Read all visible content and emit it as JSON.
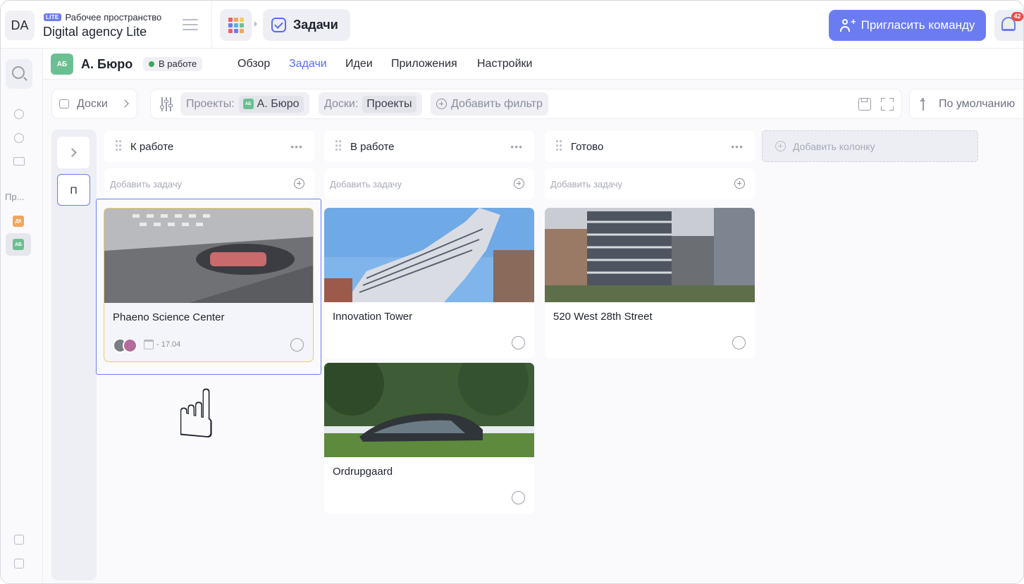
{
  "workspace": {
    "avatar": "DA",
    "badge": "LITE",
    "subtitle": "Рабочее пространство",
    "name": "Digital agency Lite"
  },
  "breadcrumb": {
    "current": "Задачи"
  },
  "header": {
    "invite_label": "Пригласить команду",
    "notifications_count": "42"
  },
  "sidebar": {
    "section_label": "Пр...",
    "projects": [
      {
        "abbr": "ДК",
        "color": "#f2a65a"
      },
      {
        "abbr": "АБ",
        "color": "#6bbf92"
      }
    ]
  },
  "project": {
    "abbr": "АБ",
    "name": "А. Бюро",
    "status": "В работе",
    "tabs": [
      "Обзор",
      "Задачи",
      "Идеи",
      "Приложения",
      "Настройки"
    ],
    "active_tab": "Задачи"
  },
  "filters": {
    "boards_label": "Доски",
    "projects_label": "Проекты:",
    "projects_value": "А. Бюро",
    "projects_value_abbr": "АБ",
    "boards_filter_label": "Доски:",
    "boards_filter_value": "Проекты",
    "add_filter": "Добавить фильтр",
    "sort_label": "По умолчанию"
  },
  "board": {
    "collapsed_column_letter": "П",
    "add_task_placeholder": "Добавить задачу",
    "add_column_label": "Добавить колонку",
    "columns": [
      {
        "title": "К работе",
        "cards": [
          {
            "title": "Phaeno Science Center",
            "date": "- 17.04",
            "selected": true
          }
        ]
      },
      {
        "title": "В работе",
        "cards": [
          {
            "title": "Innovation Tower"
          },
          {
            "title": "Ordrupgaard"
          }
        ]
      },
      {
        "title": "Готово",
        "cards": [
          {
            "title": "520 West 28th Street"
          }
        ]
      }
    ]
  },
  "colors": {
    "accent": "#6b7cf3",
    "status_dot": "#3aa85a",
    "project_color": "#6bbf92"
  }
}
